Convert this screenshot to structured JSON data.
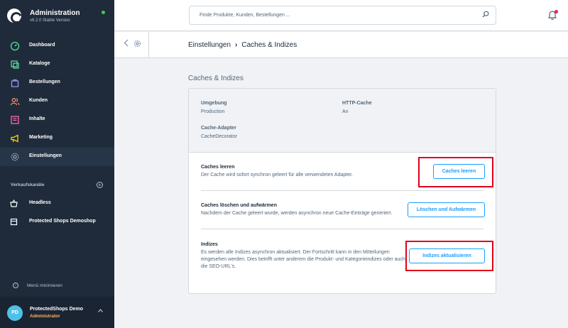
{
  "app": {
    "title": "Administration",
    "version": "v6.2.0 Stable Version"
  },
  "nav": {
    "items": [
      {
        "label": "Dashboard",
        "icon": "gauge-icon",
        "color": "#57d9a3"
      },
      {
        "label": "Kataloge",
        "icon": "catalog-icon",
        "color": "#57d9a3"
      },
      {
        "label": "Bestellungen",
        "icon": "shopping-bag-icon",
        "color": "#a092f0"
      },
      {
        "label": "Kunden",
        "icon": "users-icon",
        "color": "#f88962"
      },
      {
        "label": "Inhalte",
        "icon": "content-icon",
        "color": "#ff68b4"
      },
      {
        "label": "Marketing",
        "icon": "megaphone-icon",
        "color": "#ffd700"
      },
      {
        "label": "Einstellungen",
        "icon": "settings-icon",
        "color": "#9aa8b5"
      }
    ]
  },
  "sales_channels": {
    "title": "Verkaufskanäle",
    "items": [
      {
        "label": "Headless",
        "icon": "basket-icon"
      },
      {
        "label": "Protected Shops Demoshop",
        "icon": "storefront-icon"
      }
    ]
  },
  "collapse_label": "Menü minimieren",
  "user": {
    "initials": "PD",
    "name": "ProtectedShops Demo",
    "role": "Administrator"
  },
  "search": {
    "placeholder": "Finde Produkte, Kunden, Bestellungen ..."
  },
  "breadcrumb": {
    "parent": "Einstellungen",
    "separator": "›",
    "current": "Caches & Indizes"
  },
  "content": {
    "title": "Caches & Indizes",
    "info": {
      "environment_label": "Umgebung",
      "environment_value": "Production",
      "http_cache_label": "HTTP-Cache",
      "http_cache_value": "An",
      "cache_adapter_label": "Cache-Adapter",
      "cache_adapter_value": "CacheDecorator"
    },
    "rows": [
      {
        "title": "Caches leeren",
        "description": "Der Cache wird sofort synchron geleert für alle verwendeten Adapter.",
        "button": "Caches leeren"
      },
      {
        "title": "Caches löschen und aufwärmen",
        "description": "Nachdem der Cache geleert wurde, werden asynchron neue Cache-Einträge generiert.",
        "button": "Löschen und Aufwärmen"
      },
      {
        "title": "Indizes",
        "description_lines": [
          "Es werden alle Indizes asynchron aktualisiert. Der Fortschritt kann in den Mitteilungen",
          "eingesehen werden. Dies betrifft unter anderem die Produkt- und Kategorieindizes oder auch",
          "die SEO-URL's."
        ],
        "button": "Indizes aktualisieren"
      }
    ]
  },
  "colors": {
    "accent": "#189eff",
    "sidebar": "#1f2b3a",
    "highlight": "#e0001b",
    "status_online": "#37d046"
  }
}
